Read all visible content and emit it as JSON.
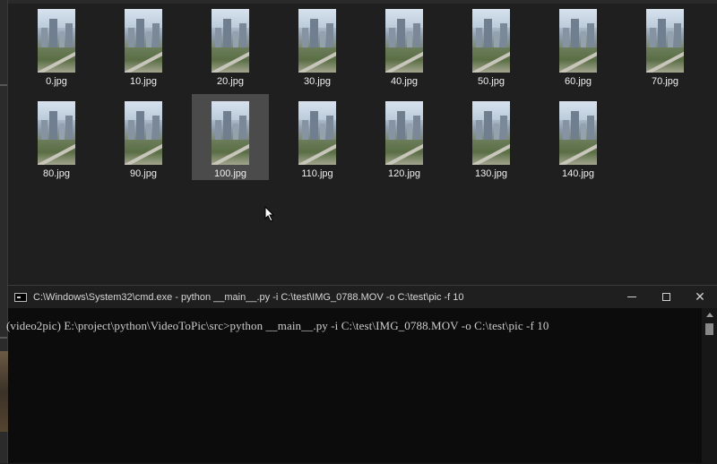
{
  "explorer": {
    "files": [
      {
        "name": "0.jpg"
      },
      {
        "name": "10.jpg"
      },
      {
        "name": "20.jpg"
      },
      {
        "name": "30.jpg"
      },
      {
        "name": "40.jpg"
      },
      {
        "name": "50.jpg"
      },
      {
        "name": "60.jpg"
      },
      {
        "name": "70.jpg"
      },
      {
        "name": "80.jpg"
      },
      {
        "name": "90.jpg"
      },
      {
        "name": "100.jpg",
        "selected": true
      },
      {
        "name": "110.jpg"
      },
      {
        "name": "120.jpg"
      },
      {
        "name": "130.jpg"
      },
      {
        "name": "140.jpg"
      }
    ]
  },
  "cmd": {
    "title": "C:\\Windows\\System32\\cmd.exe - python  __main__.py -i C:\\test\\IMG_0788.MOV -o C:\\test\\pic -f 10",
    "minimize_icon": "minimize-icon",
    "maximize_icon": "maximize-icon",
    "close_icon": "close-icon",
    "close_glyph": "✕",
    "prompt": "(video2pic) E:\\project\\python\\VideoToPic\\src>python __main__.py -i C:\\test\\IMG_0788.MOV -o C:\\test\\pic -f 10"
  }
}
